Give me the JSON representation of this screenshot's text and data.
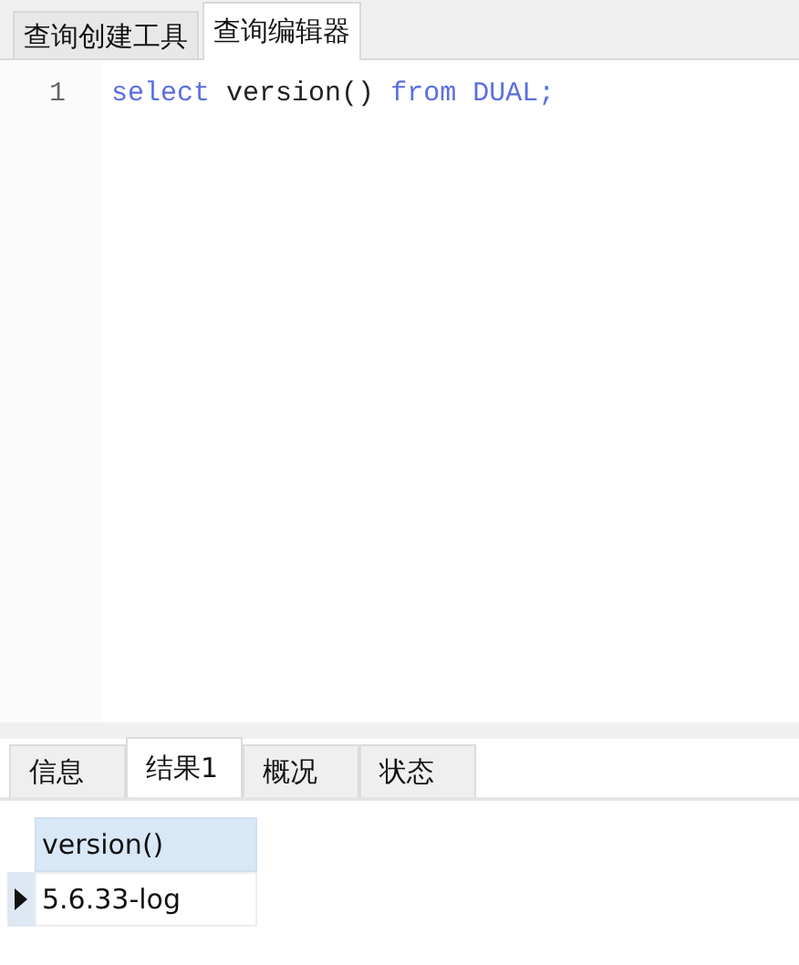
{
  "top_tabs": [
    {
      "label": "查询创建工具",
      "selected": false
    },
    {
      "label": "查询编辑器",
      "selected": true
    }
  ],
  "editor": {
    "lines": [
      {
        "number": "1",
        "tokens": [
          {
            "text": "select",
            "kind": "keyword"
          },
          {
            "text": "version()",
            "kind": "plain"
          },
          {
            "text": "from",
            "kind": "keyword"
          },
          {
            "text": "DUAL;",
            "kind": "identifier"
          }
        ]
      }
    ]
  },
  "result_tabs": [
    {
      "label": "信息",
      "selected": false
    },
    {
      "label": "结果1",
      "selected": true
    },
    {
      "label": "概况",
      "selected": false
    },
    {
      "label": "状态",
      "selected": false
    }
  ],
  "result_table": {
    "columns": [
      "version()"
    ],
    "rows": [
      {
        "current": true,
        "cells": [
          "5.6.33-log"
        ]
      }
    ]
  }
}
